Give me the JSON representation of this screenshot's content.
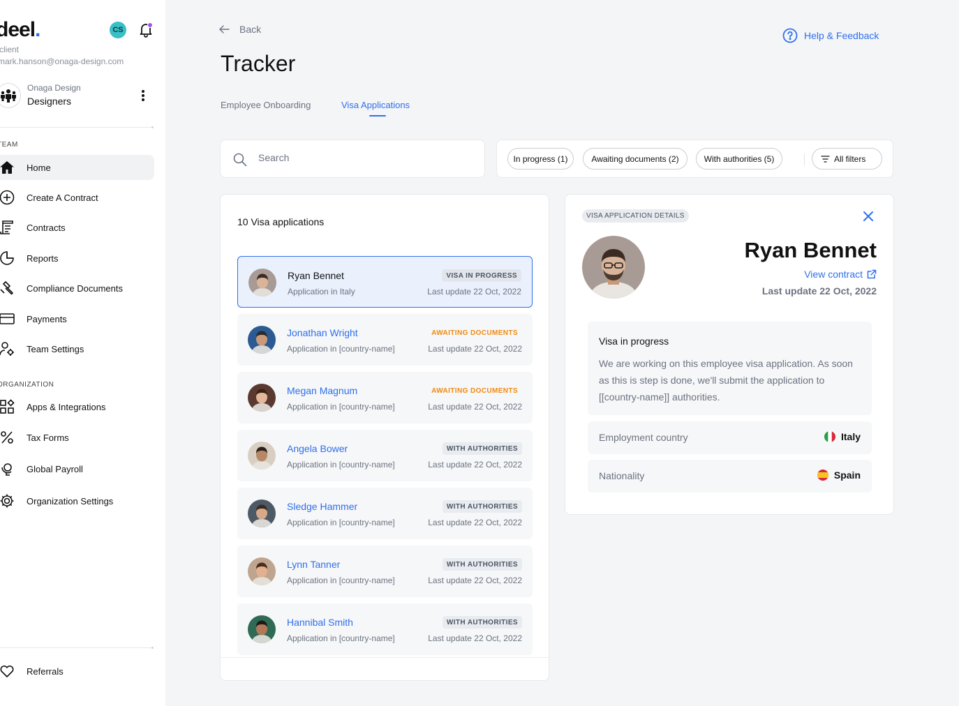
{
  "sidebar": {
    "logo_text": "deel",
    "logo_dot": ".",
    "role": "client",
    "email": "mark.hanson@onaga-design.com",
    "user_initials": "CS",
    "org": {
      "company": "Onaga Design",
      "team": "Designers"
    },
    "team_label": "TEAM",
    "org_label": "ORGANIZATION",
    "team_items": [
      {
        "label": "Home",
        "icon": "home-icon",
        "active": true
      },
      {
        "label": "Create A Contract",
        "icon": "plus-circle-icon"
      },
      {
        "label": "Contracts",
        "icon": "document-icon"
      },
      {
        "label": "Reports",
        "icon": "pie-chart-icon"
      },
      {
        "label": "Compliance Documents",
        "icon": "gavel-icon"
      },
      {
        "label": "Payments",
        "icon": "credit-card-icon"
      },
      {
        "label": "Team Settings",
        "icon": "user-gear-icon"
      }
    ],
    "org_items": [
      {
        "label": "Apps & Integrations",
        "icon": "apps-icon"
      },
      {
        "label": "Tax Forms",
        "icon": "percent-icon"
      },
      {
        "label": "Global Payroll",
        "icon": "globe-icon"
      },
      {
        "label": "Organization Settings",
        "icon": "gear-icon"
      }
    ],
    "footer_items": [
      {
        "label": "Referrals",
        "icon": "heart-icon"
      }
    ]
  },
  "header": {
    "back_label": "Back",
    "help_label": "Help & Feedback",
    "title": "Tracker",
    "tabs": [
      {
        "label": "Employee Onboarding",
        "active": false
      },
      {
        "label": "Visa Applications",
        "active": true
      }
    ]
  },
  "search": {
    "placeholder": "Search"
  },
  "filters": {
    "chips": [
      "In progress (1)",
      "Awaiting documents (2)",
      "With authorities (5)"
    ],
    "all_filters": "All filters"
  },
  "list": {
    "count_label": "10 Visa applications",
    "items": [
      {
        "name": "Ryan Bennet",
        "sub": "Application in Italy",
        "status": "VISA IN PROGRESS",
        "status_type": "progress",
        "updated": "Last update 22 Oct, 2022",
        "selected": true,
        "skin": "#d9b49a",
        "hair": "#3a2c24",
        "bg": "#a89a94"
      },
      {
        "name": "Jonathan Wright",
        "sub": "Application in [country-name]",
        "status": "AWAITING  DOCUMENTS",
        "status_type": "awaiting",
        "updated": "Last update 22 Oct, 2022",
        "skin": "#c99a7a",
        "hair": "#2b2b2b",
        "bg": "#2c5a92"
      },
      {
        "name": "Megan Magnum",
        "sub": "Application in [country-name]",
        "status": "AWAITING  DOCUMENTS",
        "status_type": "awaiting",
        "updated": "Last update 22 Oct, 2022",
        "skin": "#e4b79a",
        "hair": "#3b2216",
        "bg": "#5a3a30"
      },
      {
        "name": "Angela Bower",
        "sub": "Application in [country-name]",
        "status": "WITH AUTHORITIES",
        "status_type": "authorities",
        "updated": "Last update 22 Oct, 2022",
        "skin": "#b88866",
        "hair": "#2a211c",
        "bg": "#d8cfc2"
      },
      {
        "name": "Sledge Hammer",
        "sub": "Application in [country-name]",
        "status": "WITH AUTHORITIES",
        "status_type": "authorities",
        "updated": "Last update 22 Oct, 2022",
        "skin": "#d6a98a",
        "hair": "#3b2a1f",
        "bg": "#4d5a66"
      },
      {
        "name": "Lynn Tanner",
        "sub": "Application in [country-name]",
        "status": "WITH AUTHORITIES",
        "status_type": "authorities",
        "updated": "Last update 22 Oct, 2022",
        "skin": "#e0b08f",
        "hair": "#4a2d1c",
        "bg": "#bfa58f"
      },
      {
        "name": "Hannibal Smith",
        "sub": "Application in [country-name]",
        "status": "WITH AUTHORITIES",
        "status_type": "authorities",
        "updated": "Last update 22 Oct, 2022",
        "skin": "#b07a5a",
        "hair": "#1e1a17",
        "bg": "#2f6a54"
      }
    ]
  },
  "details": {
    "badge": "VISA APPLICATION DETAILS",
    "name": "Ryan Bennet",
    "view_contract": "View contract",
    "updated": "Last update 22 Oct, 2022",
    "info_title": "Visa in progress",
    "info_text": "We are working on this employee visa application. As soon as this is step is done, we'll submit the application to [[country-name]] authorities.",
    "employment_country_label": "Employment country",
    "employment_country": "Italy",
    "nationality_label": "Nationality",
    "nationality": "Spain"
  },
  "colors": {
    "accent": "#2f6fed",
    "awaiting": "#f08a11",
    "notification_dot": "#a157e6",
    "initials_avatar": "#39c0c6"
  }
}
